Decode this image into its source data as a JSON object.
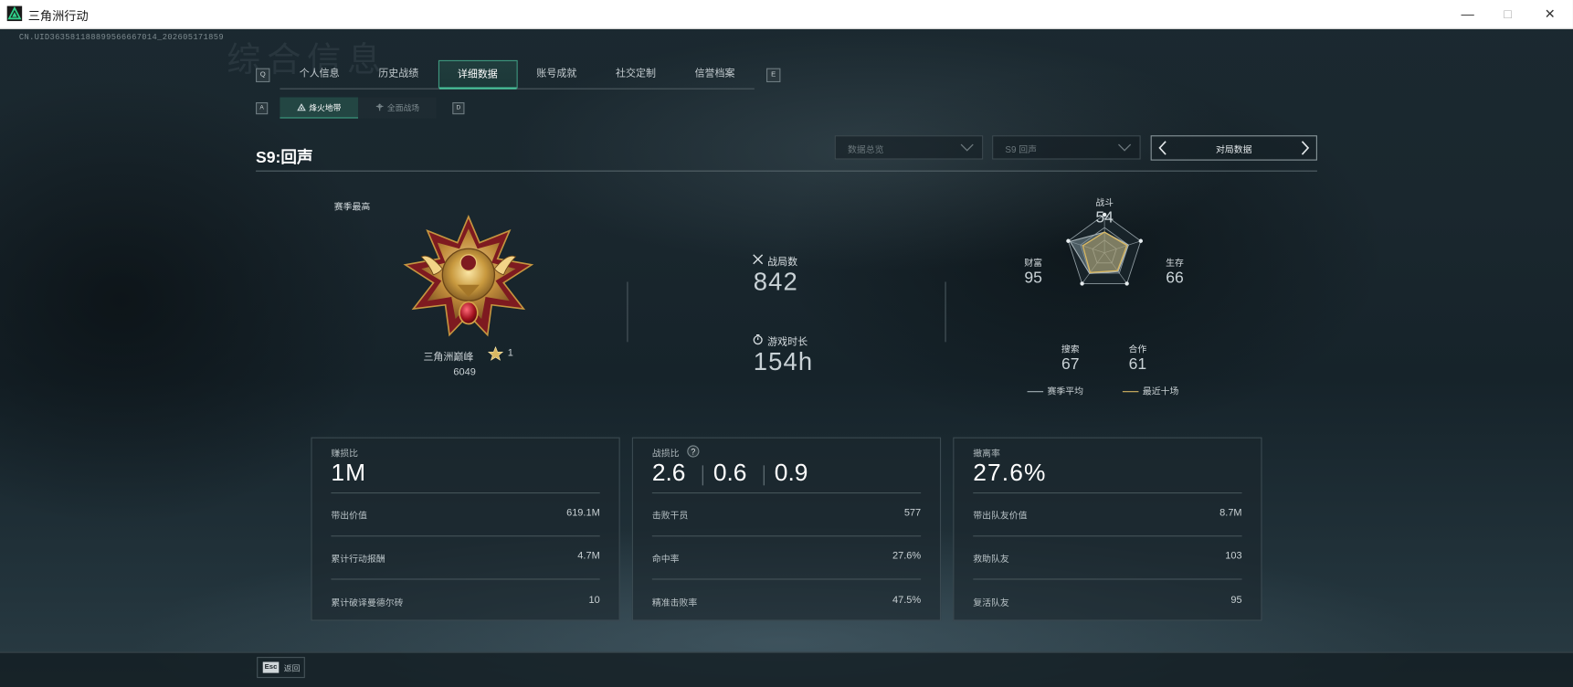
{
  "window": {
    "title": "三角洲行动",
    "minimize": "—",
    "maximize": "□",
    "close": "✕"
  },
  "uid": "CN.UID363581188899566667014_202605171859",
  "ghost_title": "综合信息",
  "nav": {
    "left_key": "Q",
    "right_key": "E",
    "tabs": [
      "个人信息",
      "历史战绩",
      "详细数据",
      "账号成就",
      "社交定制",
      "信誉档案"
    ],
    "active_index": 2
  },
  "subnav": {
    "left_key": "A",
    "right_key": "D",
    "tabs": [
      "烽火地带",
      "全面战场"
    ],
    "active_index": 0
  },
  "season": {
    "title": "S9:回声"
  },
  "filters": {
    "dropdown1": "数据总览",
    "dropdown2": "S9 回声",
    "pager_label": "对局数据"
  },
  "rank": {
    "season_best_label": "赛季最高",
    "name": "三角洲巅峰",
    "stars": "1",
    "score": "6049"
  },
  "stats": {
    "matches_label": "战局数",
    "matches": "842",
    "playtime_label": "游戏时长",
    "playtime": "154h"
  },
  "radar": {
    "axes": [
      {
        "label": "战斗",
        "value": "54",
        "season_avg": 0.54,
        "recent_ten": 0.54
      },
      {
        "label": "生存",
        "value": "66",
        "season_avg": 0.66,
        "recent_ten": 0.62
      },
      {
        "label": "合作",
        "value": "61",
        "season_avg": 0.61,
        "recent_ten": 0.58
      },
      {
        "label": "搜索",
        "value": "67",
        "season_avg": 0.67,
        "recent_ten": 0.64
      },
      {
        "label": "财富",
        "value": "95",
        "season_avg": 0.95,
        "recent_ten": 0.6
      }
    ],
    "legend_avg": "赛季平均",
    "legend_recent": "最近十场",
    "color_avg": "#a8b4b9",
    "color_recent": "#d9b862"
  },
  "cards": {
    "profit": {
      "title": "赚损比",
      "big": "1M",
      "rows": [
        {
          "label": "带出价值",
          "value": "619.1M"
        },
        {
          "label": "累计行动报酬",
          "value": "4.7M"
        },
        {
          "label": "累计破译曼德尔砖",
          "value": "10"
        }
      ]
    },
    "combat": {
      "title": "战损比",
      "help": "?",
      "values": [
        "2.6",
        "0.6",
        "0.9"
      ],
      "rows": [
        {
          "label": "击败干员",
          "value": "577"
        },
        {
          "label": "命中率",
          "value": "27.6%"
        },
        {
          "label": "精准击败率",
          "value": "47.5%"
        }
      ]
    },
    "extract": {
      "title": "撤离率",
      "big": "27.6%",
      "rows": [
        {
          "label": "带出队友价值",
          "value": "8.7M"
        },
        {
          "label": "救助队友",
          "value": "103"
        },
        {
          "label": "复活队友",
          "value": "95"
        }
      ]
    }
  },
  "footer": {
    "key": "Esc",
    "label": "返回"
  },
  "colors": {
    "accent": "#3fa385",
    "gold": "#d9b862"
  }
}
